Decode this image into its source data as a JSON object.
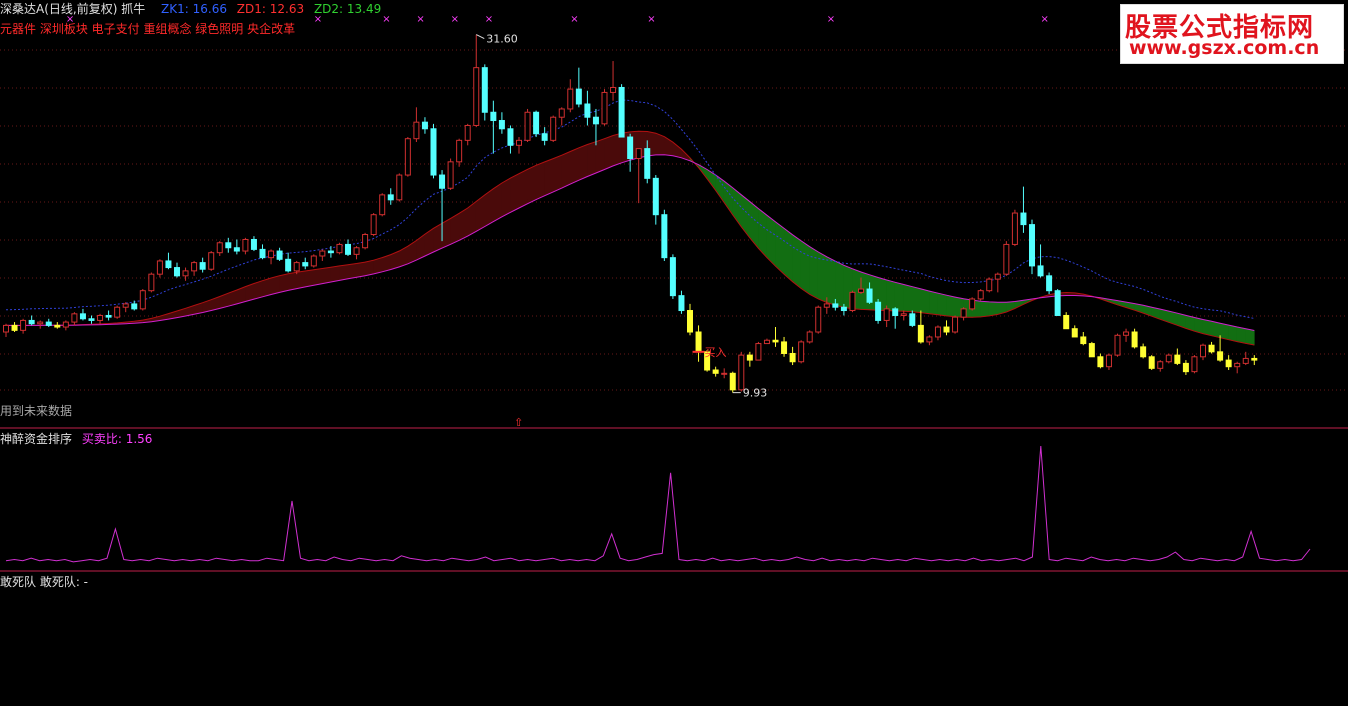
{
  "colors": {
    "bg": "#000000",
    "up": "#d03030",
    "down": "#54ffff",
    "yellow": "#ffff33",
    "grid": "#8a2020",
    "sep": "#c0204a",
    "upper_ma": "#3040d8",
    "band_up": "#4a0a0a",
    "band_down": "#126e12",
    "band_edge1": "#b01010",
    "band_edge2": "#d020d0",
    "osc": "#d030d0",
    "magenta": "#ff40ff",
    "red": "#ff3030",
    "white": "#e0e0e0"
  },
  "header": {
    "stock_title": "深桑达A(日线,前复权) 抓牛",
    "zk1_label": "ZK1: 16.66",
    "zd1_label": "ZD1: 12.63",
    "zd2_label": "ZD2: 13.49",
    "concepts": "元器件 深圳板块 电子支付 重组概念 绿色照明 央企改革"
  },
  "main_panel": {
    "note": "用到未来数据",
    "buy_label": "买入",
    "high_label": "31.60",
    "low_label": "9.93",
    "arrow_marker": "⇧"
  },
  "osc_panel": {
    "title": "神醉资金排序",
    "ratio_label": "买卖比: 1.56"
  },
  "bottom_panel": {
    "title": "敢死队 敢死队: -"
  },
  "watermark": {
    "line1": "股票公式指标网",
    "line2": "www.gszx.com.cn"
  },
  "chart_data": [
    {
      "type": "candlestick",
      "title": "",
      "ylim": [
        9,
        32
      ],
      "high_label": 31.6,
      "low_label": 9.93,
      "candles": [
        [
          13.6,
          14.1,
          13.3,
          14.0
        ],
        [
          14.0,
          14.2,
          13.6,
          13.7
        ],
        [
          13.7,
          14.4,
          13.5,
          14.3
        ],
        [
          14.3,
          14.6,
          14.0,
          14.1
        ],
        [
          14.1,
          14.3,
          13.8,
          14.2
        ],
        [
          14.2,
          14.4,
          13.9,
          14.0
        ],
        [
          14.0,
          14.2,
          13.8,
          13.9
        ],
        [
          13.9,
          14.3,
          13.7,
          14.2
        ],
        [
          14.2,
          14.8,
          14.0,
          14.7
        ],
        [
          14.7,
          15.0,
          14.3,
          14.4
        ],
        [
          14.4,
          14.6,
          14.1,
          14.3
        ],
        [
          14.3,
          14.7,
          14.1,
          14.6
        ],
        [
          14.6,
          14.9,
          14.3,
          14.5
        ],
        [
          14.5,
          15.2,
          14.4,
          15.1
        ],
        [
          15.1,
          15.4,
          14.8,
          15.3
        ],
        [
          15.3,
          15.5,
          14.9,
          15.0
        ],
        [
          15.0,
          16.2,
          14.9,
          16.1
        ],
        [
          16.1,
          17.2,
          16.0,
          17.1
        ],
        [
          17.1,
          18.0,
          16.9,
          17.9
        ],
        [
          17.9,
          18.4,
          17.4,
          17.5
        ],
        [
          17.5,
          17.8,
          16.9,
          17.0
        ],
        [
          17.0,
          17.5,
          16.7,
          17.3
        ],
        [
          17.3,
          17.9,
          17.0,
          17.8
        ],
        [
          17.8,
          18.1,
          17.2,
          17.4
        ],
        [
          17.4,
          18.5,
          17.3,
          18.4
        ],
        [
          18.4,
          19.1,
          18.2,
          19.0
        ],
        [
          19.0,
          19.3,
          18.4,
          18.7
        ],
        [
          18.7,
          19.2,
          18.3,
          18.5
        ],
        [
          18.5,
          19.3,
          18.3,
          19.2
        ],
        [
          19.2,
          19.4,
          18.5,
          18.6
        ],
        [
          18.6,
          18.9,
          18.0,
          18.1
        ],
        [
          18.1,
          18.6,
          17.7,
          18.5
        ],
        [
          18.5,
          18.7,
          17.9,
          18.0
        ],
        [
          18.0,
          18.4,
          17.2,
          17.3
        ],
        [
          17.3,
          17.9,
          17.1,
          17.8
        ],
        [
          17.8,
          18.1,
          17.4,
          17.6
        ],
        [
          17.6,
          18.3,
          17.5,
          18.2
        ],
        [
          18.2,
          18.6,
          17.9,
          18.5
        ],
        [
          18.5,
          18.8,
          18.1,
          18.4
        ],
        [
          18.4,
          19.0,
          18.3,
          18.9
        ],
        [
          18.9,
          19.2,
          18.2,
          18.3
        ],
        [
          18.3,
          18.8,
          18.0,
          18.7
        ],
        [
          18.7,
          19.6,
          18.6,
          19.5
        ],
        [
          19.5,
          20.8,
          19.4,
          20.7
        ],
        [
          20.7,
          22.0,
          20.6,
          21.9
        ],
        [
          21.9,
          22.3,
          21.3,
          21.6
        ],
        [
          21.6,
          23.2,
          21.5,
          23.1
        ],
        [
          23.1,
          25.4,
          23.0,
          25.3
        ],
        [
          25.3,
          27.2,
          25.1,
          26.3
        ],
        [
          26.3,
          26.6,
          25.6,
          25.9
        ],
        [
          25.9,
          26.2,
          22.9,
          23.1
        ],
        [
          23.1,
          23.4,
          19.1,
          22.3
        ],
        [
          22.3,
          24.1,
          22.2,
          23.9
        ],
        [
          23.9,
          25.3,
          23.6,
          25.2
        ],
        [
          25.2,
          26.2,
          24.9,
          26.1
        ],
        [
          26.1,
          31.6,
          26.0,
          29.6
        ],
        [
          29.6,
          29.8,
          26.4,
          26.9
        ],
        [
          26.9,
          27.6,
          24.4,
          26.4
        ],
        [
          26.4,
          26.9,
          25.6,
          25.9
        ],
        [
          25.9,
          26.1,
          24.4,
          24.9
        ],
        [
          24.9,
          25.4,
          24.4,
          25.2
        ],
        [
          25.2,
          27.1,
          25.1,
          26.9
        ],
        [
          26.9,
          27.0,
          25.4,
          25.6
        ],
        [
          25.6,
          26.0,
          24.9,
          25.2
        ],
        [
          25.2,
          26.7,
          25.1,
          26.6
        ],
        [
          26.6,
          27.2,
          26.1,
          27.1
        ],
        [
          27.1,
          28.9,
          26.9,
          28.3
        ],
        [
          28.3,
          29.6,
          27.2,
          27.4
        ],
        [
          27.4,
          28.2,
          26.1,
          26.6
        ],
        [
          26.6,
          27.1,
          24.9,
          26.2
        ],
        [
          26.2,
          28.3,
          26.1,
          28.1
        ],
        [
          28.1,
          30.0,
          27.6,
          28.4
        ],
        [
          28.4,
          28.6,
          26.7,
          25.4
        ],
        [
          25.4,
          25.6,
          23.3,
          24.1
        ],
        [
          24.1,
          24.7,
          21.4,
          24.7
        ],
        [
          24.7,
          25.2,
          22.6,
          22.9
        ],
        [
          22.9,
          23.1,
          20.1,
          20.7
        ],
        [
          20.7,
          21.0,
          17.9,
          18.1
        ],
        [
          18.1,
          18.3,
          15.6,
          15.8
        ],
        [
          15.8,
          16.1,
          14.7,
          14.9
        ],
        [
          14.9,
          15.3,
          13.4,
          13.6
        ],
        [
          13.6,
          14.0,
          11.8,
          12.4
        ],
        [
          12.4,
          12.5,
          11.2,
          11.3
        ],
        [
          11.3,
          11.5,
          10.9,
          11.1
        ],
        [
          11.1,
          11.4,
          10.8,
          11.1
        ],
        [
          11.1,
          11.2,
          9.93,
          10.1
        ],
        [
          10.1,
          12.4,
          10.0,
          12.2
        ],
        [
          12.2,
          12.4,
          11.5,
          11.9
        ],
        [
          11.9,
          13.0,
          11.9,
          12.9
        ],
        [
          12.9,
          13.2,
          13.0,
          13.1
        ],
        [
          13.1,
          13.9,
          12.7,
          13.0
        ],
        [
          13.0,
          13.3,
          12.1,
          12.3
        ],
        [
          12.3,
          12.7,
          11.6,
          11.8
        ],
        [
          11.8,
          13.1,
          11.7,
          13.0
        ],
        [
          13.0,
          13.7,
          12.9,
          13.6
        ],
        [
          13.6,
          15.2,
          13.5,
          15.1
        ],
        [
          15.1,
          15.7,
          14.7,
          15.3
        ],
        [
          15.3,
          15.6,
          14.9,
          15.1
        ],
        [
          15.1,
          15.3,
          14.6,
          14.9
        ],
        [
          14.9,
          16.1,
          14.8,
          16.0
        ],
        [
          16.0,
          16.9,
          15.9,
          16.2
        ],
        [
          16.2,
          16.6,
          15.3,
          15.4
        ],
        [
          15.4,
          15.6,
          14.1,
          14.3
        ],
        [
          14.3,
          15.2,
          13.9,
          15.0
        ],
        [
          15.0,
          15.1,
          13.8,
          14.6
        ],
        [
          14.6,
          14.9,
          14.3,
          14.7
        ],
        [
          14.7,
          14.9,
          13.9,
          14.0
        ],
        [
          14.0,
          14.9,
          12.9,
          13.0
        ],
        [
          13.0,
          13.4,
          12.8,
          13.3
        ],
        [
          13.3,
          14.0,
          13.1,
          13.9
        ],
        [
          13.9,
          14.3,
          13.4,
          13.6
        ],
        [
          13.6,
          14.6,
          13.5,
          14.5
        ],
        [
          14.5,
          15.1,
          14.3,
          15.0
        ],
        [
          15.0,
          15.7,
          14.9,
          15.6
        ],
        [
          15.6,
          16.2,
          15.5,
          16.1
        ],
        [
          16.1,
          16.9,
          16.0,
          16.8
        ],
        [
          16.8,
          17.2,
          16.0,
          17.1
        ],
        [
          17.1,
          19.1,
          17.0,
          18.9
        ],
        [
          18.9,
          21.0,
          18.8,
          20.8
        ],
        [
          20.8,
          22.4,
          19.6,
          20.1
        ],
        [
          20.1,
          20.4,
          17.1,
          17.6
        ],
        [
          17.6,
          18.9,
          16.9,
          17.0
        ],
        [
          17.0,
          17.2,
          15.9,
          16.1
        ],
        [
          16.1,
          16.2,
          14.7,
          14.6
        ],
        [
          14.6,
          14.8,
          14.0,
          13.8
        ],
        [
          13.8,
          14.0,
          13.3,
          13.3
        ],
        [
          13.3,
          13.6,
          12.8,
          12.9
        ],
        [
          12.9,
          13.0,
          12.1,
          12.1
        ],
        [
          12.1,
          12.3,
          11.4,
          11.5
        ],
        [
          11.5,
          12.3,
          11.3,
          12.2
        ],
        [
          12.2,
          13.5,
          12.1,
          13.4
        ],
        [
          13.4,
          13.8,
          13.0,
          13.6
        ],
        [
          13.6,
          13.8,
          12.6,
          12.7
        ],
        [
          12.7,
          12.9,
          12.0,
          12.1
        ],
        [
          12.1,
          12.2,
          11.3,
          11.4
        ],
        [
          11.4,
          11.9,
          11.2,
          11.8
        ],
        [
          11.8,
          12.3,
          11.7,
          12.2
        ],
        [
          12.2,
          12.6,
          11.6,
          11.7
        ],
        [
          11.7,
          11.9,
          11.0,
          11.2
        ],
        [
          11.2,
          12.2,
          11.1,
          12.1
        ],
        [
          12.1,
          12.9,
          11.9,
          12.8
        ],
        [
          12.8,
          13.0,
          12.3,
          12.4
        ],
        [
          12.4,
          13.4,
          11.8,
          11.9
        ],
        [
          11.9,
          12.2,
          11.3,
          11.5
        ],
        [
          11.5,
          11.8,
          11.1,
          11.7
        ],
        [
          11.7,
          12.4,
          11.6,
          12.0
        ],
        [
          12.0,
          12.2,
          11.6,
          11.9
        ]
      ]
    },
    {
      "type": "line",
      "title": "神醉资金排序",
      "ylabel": "",
      "ylim": [
        0,
        10
      ],
      "series": [
        {
          "name": "买卖比",
          "values": [
            0.6,
            0.7,
            0.6,
            0.8,
            0.6,
            0.7,
            0.6,
            0.7,
            0.5,
            0.6,
            0.7,
            0.6,
            0.8,
            3.2,
            0.7,
            0.6,
            0.7,
            0.6,
            0.8,
            0.7,
            0.6,
            0.7,
            0.6,
            0.7,
            0.6,
            0.8,
            0.7,
            0.6,
            0.7,
            0.6,
            0.6,
            0.8,
            0.7,
            0.6,
            5.5,
            0.8,
            0.6,
            0.7,
            0.6,
            0.9,
            0.7,
            0.6,
            0.8,
            0.7,
            0.6,
            0.7,
            0.6,
            1.0,
            0.8,
            0.7,
            0.6,
            0.7,
            0.6,
            0.8,
            0.7,
            0.6,
            0.7,
            0.9,
            0.6,
            0.7,
            0.8,
            0.6,
            0.7,
            0.6,
            0.7,
            0.8,
            0.6,
            0.7,
            0.6,
            0.7,
            0.6,
            1.0,
            2.8,
            0.8,
            0.6,
            0.7,
            0.9,
            1.1,
            1.2,
            7.8,
            0.7,
            0.6,
            0.7,
            0.6,
            0.8,
            0.6,
            0.7,
            0.6,
            0.7,
            0.8,
            0.6,
            0.7,
            0.6,
            0.7,
            0.9,
            0.7,
            0.6,
            0.8,
            0.6,
            0.7,
            0.6,
            0.7,
            0.6,
            0.8,
            0.7,
            0.6,
            0.7,
            0.6,
            0.8,
            0.7,
            0.6,
            0.7,
            0.6,
            0.7,
            0.6,
            0.8,
            0.6,
            0.7,
            0.6,
            0.7,
            0.8,
            0.6,
            0.9,
            10.0,
            0.7,
            0.6,
            0.8,
            0.7,
            0.6,
            0.9,
            0.7,
            0.6,
            0.7,
            0.6,
            0.8,
            0.7,
            0.6,
            0.7,
            0.9,
            1.3,
            0.7,
            0.6,
            0.8,
            0.7,
            0.6,
            0.7,
            0.6,
            0.9,
            3.0,
            0.8,
            0.7,
            0.6,
            0.7,
            0.6,
            0.7,
            1.56
          ]
        }
      ]
    }
  ]
}
